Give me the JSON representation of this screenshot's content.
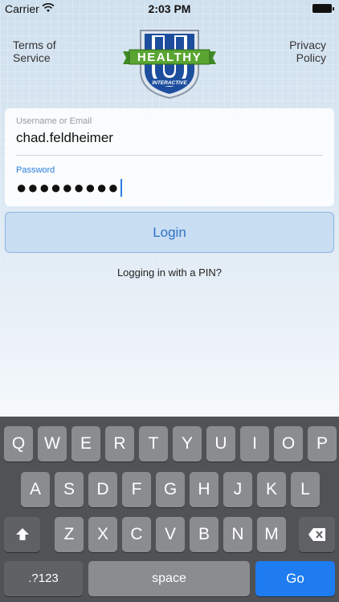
{
  "status_bar": {
    "carrier": "Carrier",
    "time": "2:03 PM"
  },
  "header": {
    "terms_line1": "Terms of",
    "terms_line2": "Service",
    "privacy_line1": "Privacy",
    "privacy_line2": "Policy",
    "logo_letter": "U",
    "logo_banner": "HEALTHY",
    "logo_sub": "INTERACTIVE"
  },
  "form": {
    "username_label": "Username or Email",
    "username_value": "chad.feldheimer",
    "password_label": "Password",
    "password_masked": "●●●●●●●●●"
  },
  "login_button": "Login",
  "pin_link": "Logging in with a PIN?",
  "keyboard": {
    "row1": [
      "Q",
      "W",
      "E",
      "R",
      "T",
      "Y",
      "U",
      "I",
      "O",
      "P"
    ],
    "row2": [
      "A",
      "S",
      "D",
      "F",
      "G",
      "H",
      "J",
      "K",
      "L"
    ],
    "row3": [
      "Z",
      "X",
      "C",
      "V",
      "B",
      "N",
      "M"
    ],
    "shift_icon": "shift-icon",
    "delete_icon": "delete-icon",
    "numbers_key": ".?123",
    "space_key": "space",
    "go_key": "Go"
  },
  "colors": {
    "accent": "#2a7ee0",
    "go_key": "#1e7cf0",
    "logo_blue": "#1d4e9e",
    "logo_green": "#5aa532"
  }
}
